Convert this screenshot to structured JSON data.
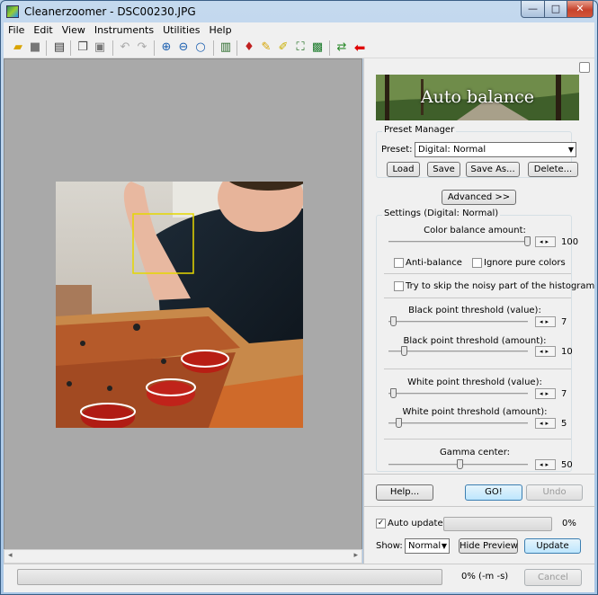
{
  "window": {
    "title": "Cleanerzoomer - DSC00230.JPG",
    "min_glyph": "—",
    "max_glyph": "□",
    "close_glyph": "✕"
  },
  "menu": [
    "File",
    "Edit",
    "View",
    "Instruments",
    "Utilities",
    "Help"
  ],
  "toolbar_icons": [
    "open-folder-icon",
    "save-icon",
    "print-icon",
    "copy-icon",
    "paste-icon",
    "undo-icon",
    "redo-icon",
    "zoom-in-icon",
    "zoom-out-icon",
    "zoom-actual-icon",
    "histogram-icon",
    "drop-icon",
    "brush-icon",
    "magic-brush-icon",
    "fit-icon",
    "image-icon",
    "arrows-icon",
    "stop-icon"
  ],
  "panel": {
    "banner_title": "Auto balance",
    "preset_manager": {
      "title": "Preset Manager",
      "preset_label": "Preset:",
      "preset_value": "Digital: Normal",
      "load": "Load",
      "save": "Save",
      "save_as": "Save As...",
      "delete": "Delete..."
    },
    "advanced": "Advanced >>",
    "settings": {
      "title": "Settings (Digital: Normal)",
      "color_balance_label": "Color balance amount:",
      "color_balance_value": "100",
      "anti_balance": "Anti-balance",
      "ignore_pure": "Ignore pure colors",
      "skip_noisy": "Try to skip the noisy part of the histogram",
      "black_value_label": "Black point threshold (value):",
      "black_value": "7",
      "black_amount_label": "Black point threshold (amount):",
      "black_amount": "10",
      "white_value_label": "White point threshold (value):",
      "white_value": "7",
      "white_amount_label": "White point threshold (amount):",
      "white_amount": "5",
      "gamma_label": "Gamma center:",
      "gamma_value": "50"
    },
    "help": "Help...",
    "go": "GO!",
    "undo": "Undo",
    "auto_update": "Auto update",
    "auto_update_checked": "✓",
    "progress_percent": "0%",
    "show_label": "Show:",
    "show_value": "Normal",
    "hide_preview": "Hide Preview",
    "update": "Update"
  },
  "status": {
    "progress_text": "0% (-m -s)",
    "cancel": "Cancel"
  },
  "colors": {
    "title_bar": "#b9d1ea",
    "close": "#c7432c",
    "canvas_bg": "#a9a9a9",
    "selection": "#e5d700"
  }
}
